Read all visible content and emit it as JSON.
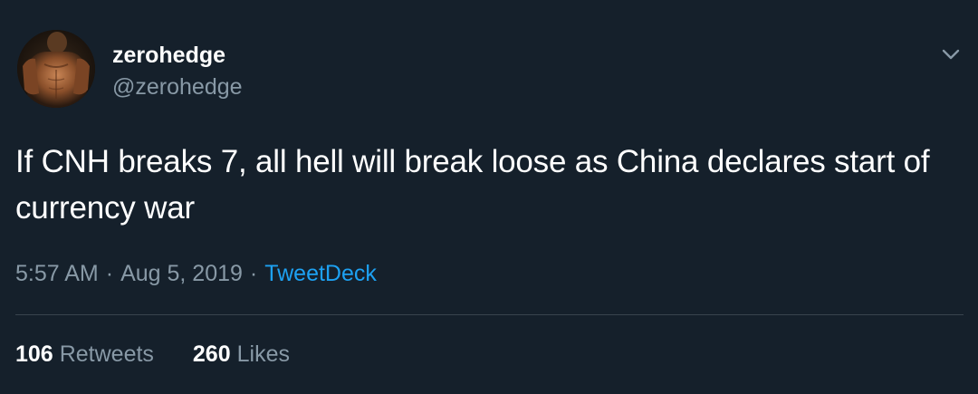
{
  "tweet": {
    "user": {
      "display_name": "zerohedge",
      "handle": "@zerohedge",
      "avatar_icon": "user-avatar-photo"
    },
    "text": "If CNH breaks 7, all hell will break loose as China declares start of currency war",
    "meta": {
      "time": "5:57 AM",
      "separator": "·",
      "date": "Aug 5, 2019",
      "source": "TweetDeck"
    },
    "stats": {
      "retweets": {
        "count": "106",
        "label": "Retweets"
      },
      "likes": {
        "count": "260",
        "label": "Likes"
      }
    },
    "menu_icon": "chevron-down-icon"
  },
  "colors": {
    "background": "#15202b",
    "primary_text": "#ffffff",
    "secondary_text": "#8899a6",
    "link": "#1da1f2",
    "divider": "#38444d"
  }
}
